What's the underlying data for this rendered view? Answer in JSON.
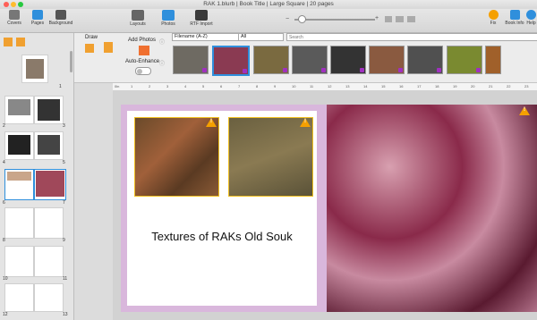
{
  "window": {
    "title": "RAK 1.blurb | Book Title | Large Square | 20 pages"
  },
  "toolbar": {
    "covers": "Covers",
    "pages": "Pages",
    "background": "Background",
    "layouts": "Layouts",
    "photos": "Photos",
    "rtf_import": "RTF Import",
    "fix": "Fix",
    "book_info": "Book Info",
    "help": "Help"
  },
  "options": {
    "draw": "Draw",
    "add_photos": "Add Photos",
    "auto_enhance": "Auto-Enhance",
    "sort_select": "Filename (A-Z)",
    "filter_select": "All",
    "search_placeholder": "Search"
  },
  "ruler": {
    "ticks": [
      "0in",
      "1",
      "2",
      "3",
      "4",
      "5",
      "6",
      "7",
      "8",
      "9",
      "10",
      "11",
      "12",
      "13",
      "14",
      "15",
      "16",
      "17",
      "18",
      "19",
      "20",
      "21",
      "22",
      "23"
    ]
  },
  "page_numbers": [
    "1",
    "2",
    "3",
    "4",
    "5",
    "6",
    "7",
    "8",
    "9",
    "10",
    "11",
    "12",
    "13"
  ],
  "canvas": {
    "page_text": "Textures of RAKs Old Souk"
  },
  "colors": {
    "accent": "#2f8fdc",
    "spread_bg": "#d9b7dc",
    "warning": "#f5a000",
    "check": "#a030c0"
  }
}
